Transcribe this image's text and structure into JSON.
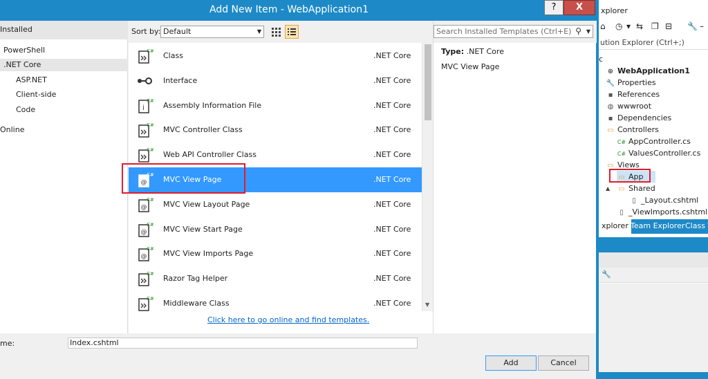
{
  "dialog": {
    "title": "Add New Item - WebApplication1",
    "help_label": "?",
    "close_label": "X",
    "left_pane": {
      "installed": "Installed",
      "nodes": [
        {
          "label": "PowerShell"
        },
        {
          "label": ".NET Core"
        },
        {
          "label": "ASP.NET"
        },
        {
          "label": "Client-side"
        },
        {
          "label": "Code"
        },
        {
          "label": "Online"
        }
      ]
    },
    "sort": {
      "label": "Sort by:",
      "value": "Default"
    },
    "search": {
      "placeholder": "Search Installed Templates (Ctrl+E)"
    },
    "templates": [
      {
        "name": "Class",
        "category": ".NET Core",
        "icon": "csharp-class-icon"
      },
      {
        "name": "Interface",
        "category": ".NET Core",
        "icon": "interface-icon"
      },
      {
        "name": "Assembly Information File",
        "category": ".NET Core",
        "icon": "assembly-info-icon"
      },
      {
        "name": "MVC Controller Class",
        "category": ".NET Core",
        "icon": "controller-icon"
      },
      {
        "name": "Web API Controller Class",
        "category": ".NET Core",
        "icon": "controller-icon"
      },
      {
        "name": "MVC View Page",
        "category": ".NET Core",
        "icon": "view-page-icon"
      },
      {
        "name": "MVC View Layout Page",
        "category": ".NET Core",
        "icon": "view-page-icon"
      },
      {
        "name": "MVC View Start Page",
        "category": ".NET Core",
        "icon": "view-page-icon"
      },
      {
        "name": "MVC View Imports Page",
        "category": ".NET Core",
        "icon": "view-page-icon"
      },
      {
        "name": "Razor Tag Helper",
        "category": ".NET Core",
        "icon": "tag-helper-icon"
      },
      {
        "name": "Middleware Class",
        "category": ".NET Core",
        "icon": "middleware-icon"
      }
    ],
    "selected_index": 5,
    "online_link": "Click here to go online and find templates.",
    "details": {
      "type_label": "Type:",
      "type_value": ".NET Core",
      "description": "MVC View Page"
    },
    "name": {
      "label": "me:",
      "value": "Index.cshtml"
    },
    "add_label": "Add",
    "cancel_label": "Cancel"
  },
  "solution_explorer": {
    "title": "xplorer",
    "search": "ution Explorer (Ctrl+;)",
    "solution_prefix": "c",
    "items": [
      {
        "label": "WebApplication1",
        "icon": "web-project-icon",
        "bold": true
      },
      {
        "label": "Properties",
        "icon": "wrench-icon"
      },
      {
        "label": "References",
        "icon": "references-icon"
      },
      {
        "label": "wwwroot",
        "icon": "globe-icon"
      },
      {
        "label": "Dependencies",
        "icon": "dependencies-icon"
      },
      {
        "label": "Controllers",
        "icon": "folder-icon"
      },
      {
        "label": "AppController.cs",
        "icon": "csharp-file-icon"
      },
      {
        "label": "ValuesController.cs",
        "icon": "csharp-file-icon"
      },
      {
        "label": "Views",
        "icon": "folder-icon"
      },
      {
        "label": "App",
        "icon": "folder-icon"
      },
      {
        "label": "Shared",
        "icon": "folder-icon"
      },
      {
        "label": "_Layout.cshtml",
        "icon": "cshtml-file-icon"
      },
      {
        "label": "_ViewImports.cshtml",
        "icon": "cshtml-file-icon"
      }
    ],
    "tabs": [
      "xplorer",
      "Team Explorer",
      "Class V"
    ]
  },
  "colors": {
    "accent": "#1d8ac7",
    "selection": "#3399ff",
    "highlight_box": "#e21b2b",
    "link": "#0066cc"
  }
}
